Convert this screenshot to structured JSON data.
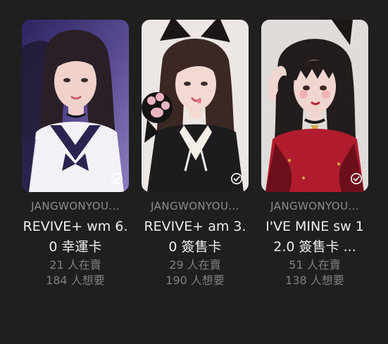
{
  "cards": [
    {
      "artist": "JANGWONYOU...",
      "title": "REVIVE+ wm 6.0 幸運卡",
      "selling": "21 人在賣",
      "wanting": "184 人想要",
      "palette": {
        "bg": "#4a3a78",
        "hair": "#2a1f27",
        "skin": "#f1d2cb",
        "outfit": "#f3f0f7",
        "accent": "#2b2451"
      }
    },
    {
      "artist": "JANGWONYOU...",
      "title": "REVIVE+ am 3.0 簽售卡",
      "selling": "29 人在賣",
      "wanting": "190 人想要",
      "palette": {
        "bg": "#ece6e4",
        "hair": "#3b2724",
        "skin": "#f3d9d2",
        "outfit": "#1c1c1e",
        "accent": "#e8b5c0"
      }
    },
    {
      "artist": "JANGWONYOU...",
      "title": "I'VE MINE sw 12.0 簽售卡 ...",
      "selling": "51 人在賣",
      "wanting": "138 人想要",
      "palette": {
        "bg": "#dfdcda",
        "hair": "#231c1c",
        "skin": "#f1d5cf",
        "outfit": "#b11d2e",
        "accent": "#d9a84a"
      }
    }
  ]
}
